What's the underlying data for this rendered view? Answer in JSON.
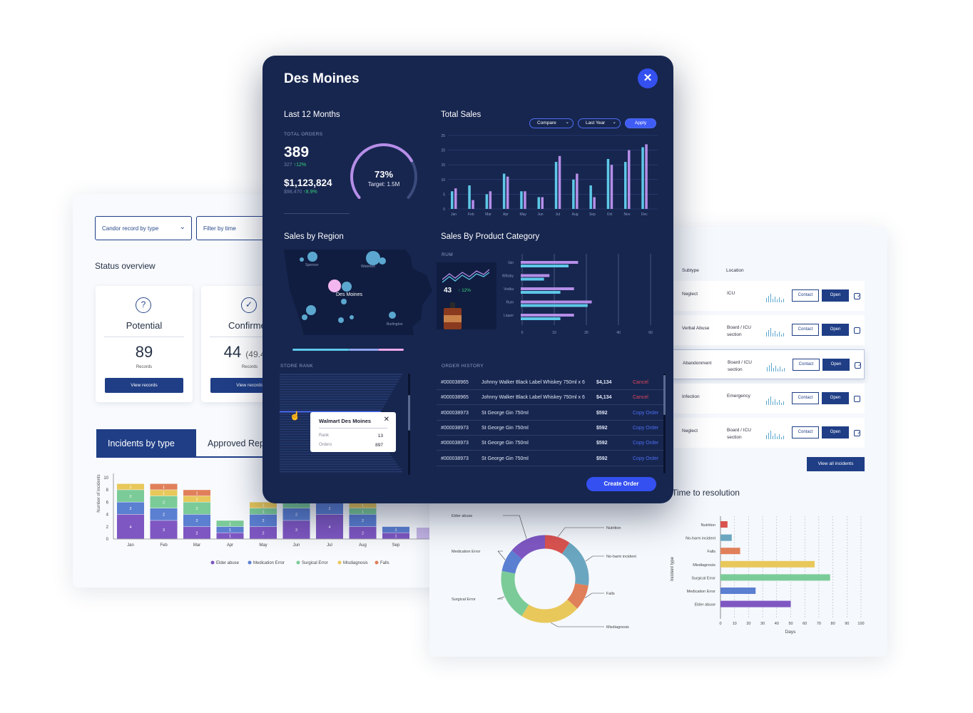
{
  "left_card": {
    "filter_type": "Candor record by type",
    "filter_time": "Filter by time",
    "status_title": "Status overview",
    "stats": [
      {
        "label": "Potential",
        "value": "89",
        "extra": "",
        "records": "Records",
        "button": "View records"
      },
      {
        "label": "Confirmed",
        "value": "44",
        "extra": "(49.4%)",
        "records": "Records",
        "button": "View records"
      }
    ],
    "tabs": [
      "Incidents by type",
      "Approved Reports"
    ],
    "ylabel": "Number of incidents",
    "y_ticks": [
      "0",
      "2",
      "4",
      "6",
      "8",
      "10"
    ],
    "legend": [
      {
        "name": "Elder abuse",
        "color": "#7e57c2"
      },
      {
        "name": "Medication Error",
        "color": "#5b7fd1"
      },
      {
        "name": "Surgical Error",
        "color": "#7bcb98"
      },
      {
        "name": "Misdiagnosis",
        "color": "#e8c85a"
      },
      {
        "name": "Falls",
        "color": "#e0805a"
      }
    ]
  },
  "chart_data": [
    {
      "type": "bar",
      "title": "Incidents by type",
      "ylabel": "Number of incidents",
      "ylim": [
        0,
        10
      ],
      "stacked": true,
      "categories": [
        "Jan",
        "Feb",
        "Mar",
        "Apr",
        "May",
        "Jun",
        "Jul",
        "Aug",
        "Sep"
      ],
      "series": [
        {
          "name": "Elder abuse",
          "values": [
            4,
            3,
            2,
            1,
            2,
            3,
            4,
            2,
            1
          ]
        },
        {
          "name": "Medication Error",
          "values": [
            2,
            2,
            2,
            1,
            2,
            2,
            2,
            2,
            1
          ]
        },
        {
          "name": "Surgical Error",
          "values": [
            2,
            2,
            2,
            1,
            1,
            2,
            0,
            1,
            0
          ]
        },
        {
          "name": "Misdiagnosis",
          "values": [
            1,
            1,
            1,
            0,
            1,
            0,
            0,
            1,
            0
          ]
        },
        {
          "name": "Falls",
          "values": [
            0,
            1,
            1,
            0,
            0,
            0,
            0,
            0,
            0
          ]
        }
      ]
    },
    {
      "type": "bar",
      "title": "Total Sales",
      "ylim": [
        0,
        25
      ],
      "categories": [
        "Jan",
        "Feb",
        "Mar",
        "Apr",
        "May",
        "Jun",
        "Jul",
        "Aug",
        "Sep",
        "Oct",
        "Nov",
        "Dec"
      ],
      "y_ticks": [
        "0",
        "5",
        "10",
        "15",
        "20",
        "25"
      ],
      "series": [
        {
          "values": [
            6,
            8,
            5,
            12,
            6,
            4,
            16,
            10,
            8,
            17,
            16,
            21
          ]
        },
        {
          "values": [
            7,
            3,
            6,
            11,
            6,
            4,
            18,
            12,
            4,
            15,
            20,
            22
          ]
        }
      ]
    },
    {
      "type": "bar",
      "title": "Sales By Product Category",
      "orientation": "horizontal",
      "xlim": [
        0,
        60
      ],
      "categories": [
        "Gin",
        "Whisky",
        "Vodka",
        "Rum",
        "Liquor"
      ],
      "x_ticks": [
        "0",
        "10",
        "20",
        "40",
        "60"
      ],
      "series": [
        {
          "values": [
            21,
            10,
            19,
            31,
            19
          ]
        },
        {
          "values": [
            17,
            8,
            14,
            28,
            14
          ]
        }
      ]
    },
    {
      "type": "pie",
      "title": "Incidents by type",
      "donut": true,
      "labels": [
        "Nutrition",
        "No-harm incident",
        "Falls",
        "Misdiagnosis",
        "Surgical Error",
        "Medication Error",
        "Elder abuse"
      ],
      "values": [
        9,
        17,
        9,
        21,
        18,
        8,
        13
      ]
    },
    {
      "type": "bar",
      "title": "Time to resolution",
      "orientation": "horizontal",
      "xlabel": "Days",
      "ylabel": "Incident type",
      "xlim": [
        0,
        100
      ],
      "categories": [
        "Nutrition",
        "No-harm incident",
        "Falls",
        "Misdiagnosis",
        "Surgical Error",
        "Medication Error",
        "Elder abuse"
      ],
      "values": [
        5,
        8,
        14,
        67,
        78,
        25,
        50
      ],
      "x_ticks": [
        "0",
        "10",
        "20",
        "30",
        "40",
        "50",
        "60",
        "70",
        "80",
        "90",
        "100"
      ]
    }
  ],
  "modal": {
    "city": "Des Moines",
    "last12": "Last 12 Months",
    "total_orders_label": "TOTAL ORDERS",
    "orders": "389",
    "orders_prev": "327",
    "orders_change": "12%",
    "revenue": "$1,123,824",
    "revenue_prev": "$98,470",
    "revenue_change": "8.9%",
    "gauge_pct": "73%",
    "gauge_target": "Target: 1.5M",
    "gauge_value": 0.73,
    "total_sales": "Total Sales",
    "compare": "Compare",
    "last_year": "Last Year",
    "apply": "Apply",
    "sales_region": "Sales by Region",
    "map_labels": [
      "Spencer",
      "Waterloo",
      "Des Moines",
      "Burlington"
    ],
    "product_cat": "Sales By Product Category",
    "rum_label": "RUM",
    "rum_value": "43",
    "rum_change": "12%",
    "store_rank": "STORE RANK",
    "tooltip": {
      "store": "Walmart Des Moines",
      "rank_label": "Rank",
      "rank": "13",
      "orders_label": "Orders",
      "orders": "897"
    },
    "order_history": "ORDER HISTORY",
    "orders_list": [
      {
        "id": "#000038965",
        "item": "Johnny Walker Black Label Whiskey 750ml x 6",
        "price": "$4,134",
        "action": "Cancel"
      },
      {
        "id": "#000038965",
        "item": "Johnny Walker Black Label Whiskey 750ml x 6",
        "price": "$4,134",
        "action": "Cancel"
      },
      {
        "id": "#000038973",
        "item": "St George Gin 750ml",
        "price": "$592",
        "action": "Copy Order"
      },
      {
        "id": "#000038973",
        "item": "St George Gin 750ml",
        "price": "$592",
        "action": "Copy Order"
      },
      {
        "id": "#000038973",
        "item": "St George Gin 750ml",
        "price": "$592",
        "action": "Copy Order"
      },
      {
        "id": "#000038973",
        "item": "St George Gin 750ml",
        "price": "$592",
        "action": "Copy Order"
      }
    ],
    "create_order": "Create Order"
  },
  "right_card": {
    "col_subtype": "Subtype",
    "col_location": "Location",
    "rows": [
      {
        "subtype": "Neglect",
        "location": "ICU",
        "checked": true
      },
      {
        "subtype": "Verbal Abuse",
        "location": "Board / ICU section",
        "checked": false
      },
      {
        "subtype": "Abandonment",
        "location": "Board / ICU section",
        "checked": true
      },
      {
        "subtype": "Infection",
        "location": "Emergency",
        "checked": false
      },
      {
        "subtype": "Neglect",
        "location": "Board / ICU section",
        "checked": true
      }
    ],
    "contact": "Contact",
    "open": "Open",
    "check": "✓",
    "view_all": "View all incidents",
    "time_title": "Time to resolution",
    "xlabel": "Days",
    "ylabel": "Incident type"
  }
}
